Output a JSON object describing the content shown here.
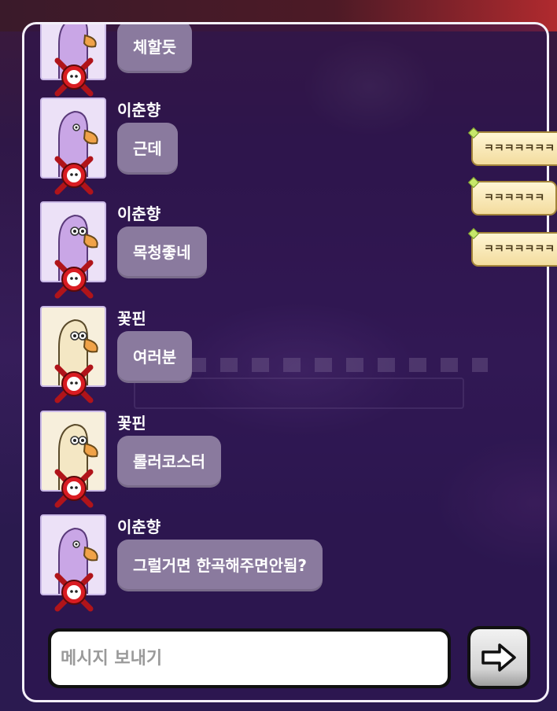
{
  "chat": {
    "messages": [
      {
        "name": "",
        "text": "체할듯",
        "avatar": "lilac-goose"
      },
      {
        "name": "이춘향",
        "text": "근데",
        "avatar": "lilac-goose"
      },
      {
        "name": "이춘향",
        "text": "목청좋네",
        "avatar": "lilac-goose"
      },
      {
        "name": "꽃핀",
        "text": "여러분",
        "avatar": "cream-goose"
      },
      {
        "name": "꽃핀",
        "text": "롤러코스터",
        "avatar": "cream-goose"
      },
      {
        "name": "이춘향",
        "text": "그럴거면 한곡해주면안됨?",
        "avatar": "lilac-goose"
      }
    ],
    "dead_badge_icon": "red-x-skull-icon"
  },
  "floating_bubbles": [
    "ㅋㅋㅋㅋㅋㅋㅋ",
    "ㅋㅋㅋㅋㅋㅋ",
    "ㅋㅋㅋㅋㅋㅋㅋ"
  ],
  "input": {
    "placeholder": "메시지 보내기",
    "value": ""
  },
  "send_button": {
    "icon": "arrow-right-icon"
  },
  "colors": {
    "panel_border": "#f4f0fa",
    "bubble": "#8a7a9e",
    "floating_bubble": "#f3dc9e",
    "background": "#2f1747"
  }
}
